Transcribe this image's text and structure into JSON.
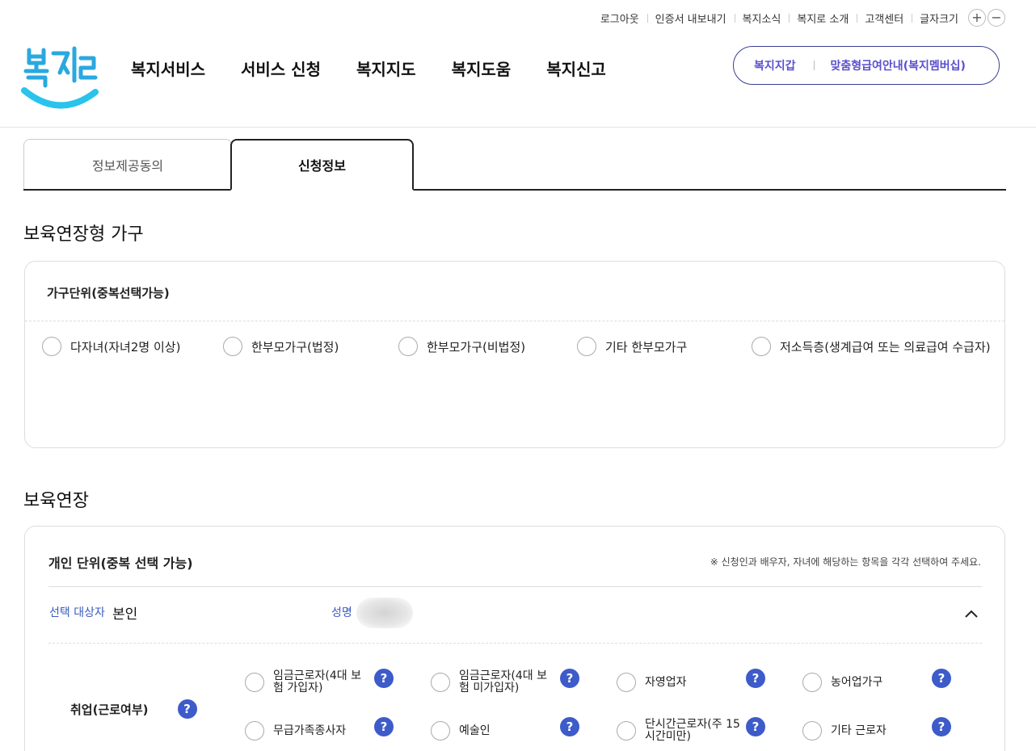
{
  "utility_menu": [
    "로그아웃",
    "인증서 내보내기",
    "복지소식",
    "복지로 소개",
    "고객센터",
    "글자크기"
  ],
  "font_controls": {
    "increase": "+",
    "decrease": "−"
  },
  "logo_text": "복지로",
  "gnb": [
    "복지서비스",
    "서비스 신청",
    "복지지도",
    "복지도움",
    "복지신고"
  ],
  "quick_links": {
    "wallet": "복지지갑",
    "membership": "맞춤형급여안내(복지멤버십)"
  },
  "tabs": [
    {
      "label": "정보제공동의",
      "active": false
    },
    {
      "label": "신청정보",
      "active": true
    }
  ],
  "section1": {
    "title": "보육연장형 가구",
    "card_heading": "가구단위(중복선택가능)",
    "options": [
      "다자녀(자녀2명 이상)",
      "한부모가구(법정)",
      "한부모가구(비법정)",
      "기타 한부모가구",
      "저소득층(생계급여 또는 의료급여 수급자)"
    ]
  },
  "section2": {
    "title": "보육연장",
    "card_heading": "개인 단위(중복 선택 가능)",
    "note": "※ 신청인과 배우자, 자녀에 해당하는 항목을 각각 선택하여 주세요.",
    "target_label": "선택 대상자",
    "target_value": "본인",
    "name_label": "성명",
    "employment_label": "취업(근로여부)",
    "help_glyph": "?",
    "employment_options": [
      "임금근로자(4대 보험 가입자)",
      "임금근로자(4대 보험 미가입자)",
      "자영업자",
      "농어업가구",
      "무급가족종사자",
      "예술인",
      "단시간근로자(주 15시간미만)",
      "기타 근로자"
    ]
  },
  "colors": {
    "accent_blue": "#3d5bc9",
    "label_blue": "#3a5bbf",
    "pill_text": "#5a4fcf",
    "logo_blue": "#2aa8e0",
    "logo_cyan": "#29c3ec"
  }
}
